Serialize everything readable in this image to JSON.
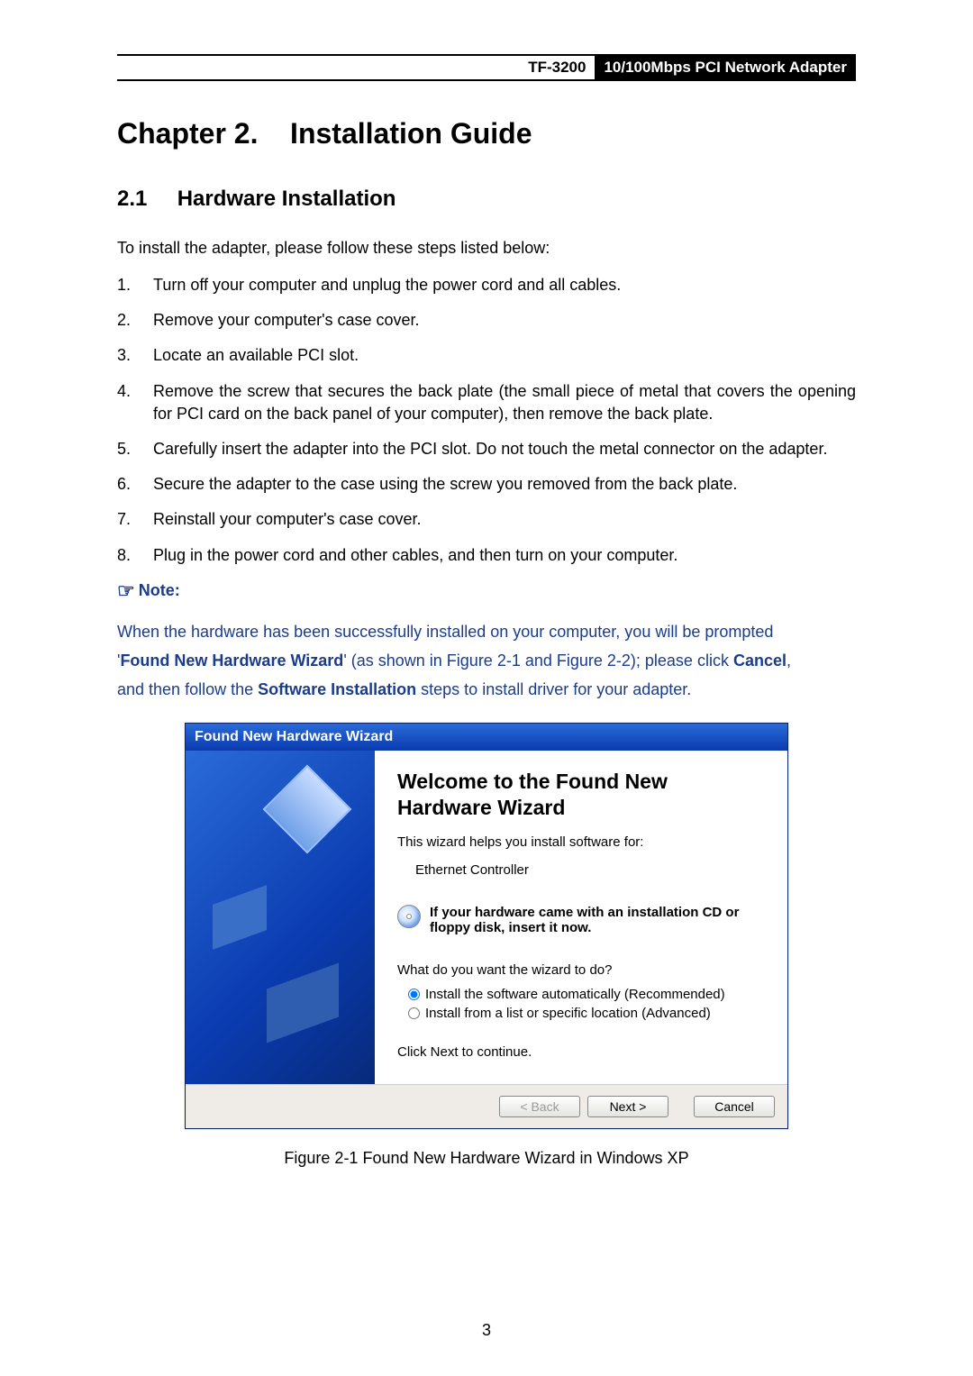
{
  "header": {
    "model": "TF-3200",
    "product": "10/100Mbps PCI Network Adapter"
  },
  "chapter_title": "Chapter 2.    Installation Guide",
  "section_title": "2.1     Hardware Installation",
  "intro": "To install the adapter, please follow these steps listed below:",
  "steps": [
    "Turn off your computer and unplug the power cord and all cables.",
    "Remove your computer's case cover.",
    "Locate an available PCI slot.",
    "Remove the screw that secures the back plate (the small piece of metal that covers the opening for PCI card on the back panel of your computer), then remove the back plate.",
    "Carefully insert the adapter into the PCI slot. Do not touch the metal connector on the adapter.",
    "Secure the adapter to the case using the screw you removed from the back plate.",
    "Reinstall your computer's case cover.",
    "Plug in the power cord and other cables, and then turn on your computer."
  ],
  "note": {
    "label": "Note:",
    "line1": "When the hardware has been successfully installed on your computer, you will be prompted",
    "bold1": "Found New Hardware Wizard",
    "mid1": "' (as shown in Figure 2-1 and Figure 2-2); please click ",
    "bold2": "Cancel",
    "tail1": ",",
    "line2a": "and then follow the ",
    "bold3": "Software Installation",
    "line2b": " steps to install driver for your adapter."
  },
  "wizard": {
    "title": "Found New Hardware Wizard",
    "heading": "Welcome to the Found New Hardware Wizard",
    "sub": "This wizard helps you install software for:",
    "device": "Ethernet Controller",
    "cd_hint": "If your hardware came with an installation CD or floppy disk, insert it now.",
    "question": "What do you want the wizard to do?",
    "opt1": "Install the software automatically (Recommended)",
    "opt2": "Install from a list or specific location (Advanced)",
    "cont": "Click Next to continue.",
    "back": "< Back",
    "next": "Next >",
    "cancel": "Cancel"
  },
  "figure_caption": "Figure 2-1 Found New Hardware Wizard in Windows XP",
  "page_number": "3"
}
